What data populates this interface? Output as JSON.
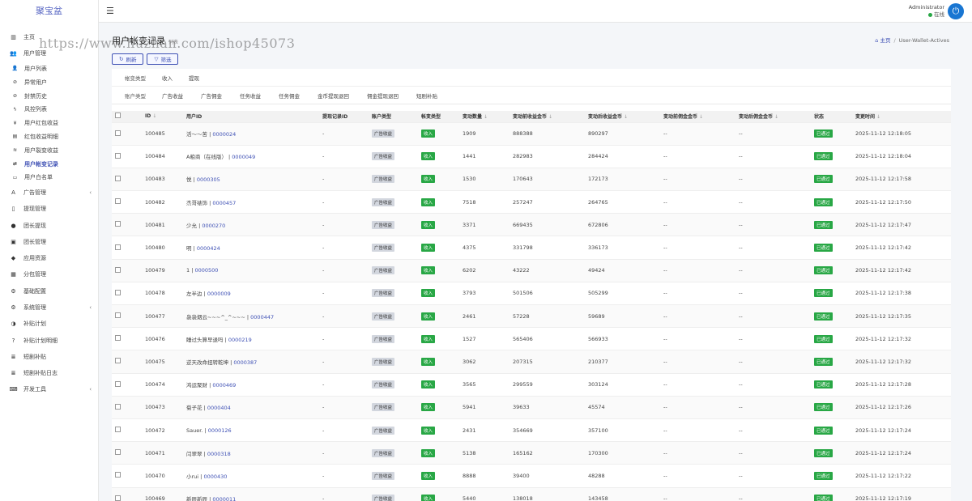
{
  "brand": "聚宝盆",
  "topbar": {
    "user_name": "Administrator",
    "user_status": "在线"
  },
  "watermark": "https://www.huzhan.com/ishop45073",
  "page": {
    "title": "用户帐变记录",
    "subtitle": "列表"
  },
  "breadcrumb": {
    "home": "主页",
    "current": "User-Wallet-Actives"
  },
  "buttons": {
    "refresh": "刷新",
    "filter": "筛选"
  },
  "sidebar": {
    "items": [
      {
        "label": "主页",
        "icon": "dashboard-icon",
        "sub": false
      },
      {
        "label": "用户管理",
        "icon": "users-icon",
        "sub": false
      },
      {
        "label": "用户列表",
        "icon": "user-list-icon",
        "sub": true
      },
      {
        "label": "异常用户",
        "icon": "ban-icon",
        "sub": true
      },
      {
        "label": "封禁历史",
        "icon": "ban-history-icon",
        "sub": true
      },
      {
        "label": "风控列表",
        "icon": "bolt-icon",
        "sub": true
      },
      {
        "label": "用户红包收益",
        "icon": "yen-icon",
        "sub": true
      },
      {
        "label": "红包收益明细",
        "icon": "ledger-icon",
        "sub": true
      },
      {
        "label": "用户裂变收益",
        "icon": "wifi-icon",
        "sub": true
      },
      {
        "label": "用户帐变记录",
        "icon": "exchange-icon",
        "sub": true,
        "active": true
      },
      {
        "label": "用户白名单",
        "icon": "id-card-icon",
        "sub": true
      },
      {
        "label": "广告管理",
        "icon": "ad-icon",
        "sub": false,
        "arrow": "‹"
      },
      {
        "label": "提现管理",
        "icon": "withdraw-icon",
        "sub": false
      },
      {
        "label": "团长提现",
        "icon": "leader-icon",
        "sub": false
      },
      {
        "label": "团长管理",
        "icon": "contact-icon",
        "sub": false
      },
      {
        "label": "应用资源",
        "icon": "android-icon",
        "sub": false
      },
      {
        "label": "分包管理",
        "icon": "package-icon",
        "sub": false
      },
      {
        "label": "基础配置",
        "icon": "cogs-icon",
        "sub": false
      },
      {
        "label": "系统管理",
        "icon": "gear-icon",
        "sub": false,
        "arrow": "‹"
      },
      {
        "label": "补贴计划",
        "icon": "pie-icon",
        "sub": false
      },
      {
        "label": "补贴计划明细",
        "icon": "question-icon",
        "sub": false
      },
      {
        "label": "短剧补贴",
        "icon": "list-icon",
        "sub": false
      },
      {
        "label": "短剧补贴日志",
        "icon": "list-log-icon",
        "sub": false
      },
      {
        "label": "开发工具",
        "icon": "keyboard-icon",
        "sub": false,
        "arrow": "‹"
      }
    ]
  },
  "filters": {
    "row1": {
      "label": "帐变类型",
      "options": [
        "收入",
        "提现"
      ]
    },
    "row2": {
      "label": "账户类型",
      "options": [
        "广告收益",
        "广告佣金",
        "任务收益",
        "任务佣金",
        "金币提现退回",
        "佣金提现退回",
        "短剧补贴"
      ]
    }
  },
  "table": {
    "columns": [
      "ID",
      "用户ID",
      "提现记录ID",
      "账户类型",
      "帐变类型",
      "变动数量",
      "变动前收益金币",
      "变动后收益金币",
      "变动前佣金金币",
      "变动后佣金金币",
      "状态",
      "变更时间"
    ],
    "rows": [
      {
        "id": "100485",
        "user": "活～～苦",
        "uid": "0000024",
        "wid": "-",
        "acct": "广告收益",
        "type": "收入",
        "amount": "1909",
        "before": "888388",
        "after": "890297",
        "cbefore": "--",
        "cafter": "--",
        "status": "已通过",
        "time": "2025-11-12 12:18:05"
      },
      {
        "id": "100484",
        "user": "A粮商（在线版）",
        "uid": "0000049",
        "wid": "-",
        "acct": "广告收益",
        "type": "收入",
        "amount": "1441",
        "before": "282983",
        "after": "284424",
        "cbefore": "--",
        "cafter": "--",
        "status": "已通过",
        "time": "2025-11-12 12:18:04"
      },
      {
        "id": "100483",
        "user": "悦",
        "uid": "0000305",
        "wid": "-",
        "acct": "广告收益",
        "type": "收入",
        "amount": "1530",
        "before": "170643",
        "after": "172173",
        "cbefore": "--",
        "cafter": "--",
        "status": "已通过",
        "time": "2025-11-12 12:17:58"
      },
      {
        "id": "100482",
        "user": "杰哥裱饰",
        "uid": "0000457",
        "wid": "-",
        "acct": "广告收益",
        "type": "收入",
        "amount": "7518",
        "before": "257247",
        "after": "264765",
        "cbefore": "--",
        "cafter": "--",
        "status": "已通过",
        "time": "2025-11-12 12:17:50"
      },
      {
        "id": "100481",
        "user": "少允",
        "uid": "0000270",
        "wid": "-",
        "acct": "广告收益",
        "type": "收入",
        "amount": "3371",
        "before": "669435",
        "after": "672806",
        "cbefore": "--",
        "cafter": "--",
        "status": "已通过",
        "time": "2025-11-12 12:17:47"
      },
      {
        "id": "100480",
        "user": "明",
        "uid": "0000424",
        "wid": "-",
        "acct": "广告收益",
        "type": "收入",
        "amount": "4375",
        "before": "331798",
        "after": "336173",
        "cbefore": "--",
        "cafter": "--",
        "status": "已通过",
        "time": "2025-11-12 12:17:42"
      },
      {
        "id": "100479",
        "user": "1",
        "uid": "0000500",
        "wid": "-",
        "acct": "广告收益",
        "type": "收入",
        "amount": "6202",
        "before": "43222",
        "after": "49424",
        "cbefore": "--",
        "cafter": "--",
        "status": "已通过",
        "time": "2025-11-12 12:17:42"
      },
      {
        "id": "100478",
        "user": "左半边",
        "uid": "0000009",
        "wid": "-",
        "acct": "广告收益",
        "type": "收入",
        "amount": "3793",
        "before": "501506",
        "after": "505299",
        "cbefore": "--",
        "cafter": "--",
        "status": "已通过",
        "time": "2025-11-12 12:17:38"
      },
      {
        "id": "100477",
        "user": "袅袅烟云~~~^_^~~~",
        "uid": "0000447",
        "wid": "-",
        "acct": "广告收益",
        "type": "收入",
        "amount": "2461",
        "before": "57228",
        "after": "59689",
        "cbefore": "--",
        "cafter": "--",
        "status": "已通过",
        "time": "2025-11-12 12:17:35"
      },
      {
        "id": "100476",
        "user": "睡过头算早退吗",
        "uid": "0000219",
        "wid": "-",
        "acct": "广告收益",
        "type": "收入",
        "amount": "1527",
        "before": "565406",
        "after": "566933",
        "cbefore": "--",
        "cafter": "--",
        "status": "已通过",
        "time": "2025-11-12 12:17:32"
      },
      {
        "id": "100475",
        "user": "逆天改命扭转乾坤",
        "uid": "0000387",
        "wid": "-",
        "acct": "广告收益",
        "type": "收入",
        "amount": "3062",
        "before": "207315",
        "after": "210377",
        "cbefore": "--",
        "cafter": "--",
        "status": "已通过",
        "time": "2025-11-12 12:17:32"
      },
      {
        "id": "100474",
        "user": "鸿运聚财",
        "uid": "0000469",
        "wid": "-",
        "acct": "广告收益",
        "type": "收入",
        "amount": "3565",
        "before": "299559",
        "after": "303124",
        "cbefore": "--",
        "cafter": "--",
        "status": "已通过",
        "time": "2025-11-12 12:17:28"
      },
      {
        "id": "100473",
        "user": "菊子花",
        "uid": "0000404",
        "wid": "-",
        "acct": "广告收益",
        "type": "收入",
        "amount": "5941",
        "before": "39633",
        "after": "45574",
        "cbefore": "--",
        "cafter": "--",
        "status": "已通过",
        "time": "2025-11-12 12:17:26"
      },
      {
        "id": "100472",
        "user": "Sauer.",
        "uid": "0000126",
        "wid": "-",
        "acct": "广告收益",
        "type": "收入",
        "amount": "2431",
        "before": "354669",
        "after": "357100",
        "cbefore": "--",
        "cafter": "--",
        "status": "已通过",
        "time": "2025-11-12 12:17:24"
      },
      {
        "id": "100471",
        "user": "闫翠翠",
        "uid": "0000318",
        "wid": "-",
        "acct": "广告收益",
        "type": "收入",
        "amount": "5138",
        "before": "165162",
        "after": "170300",
        "cbefore": "--",
        "cafter": "--",
        "status": "已通过",
        "time": "2025-11-12 12:17:24"
      },
      {
        "id": "100470",
        "user": "小rui",
        "uid": "0000430",
        "wid": "-",
        "acct": "广告收益",
        "type": "收入",
        "amount": "8888",
        "before": "39400",
        "after": "48288",
        "cbefore": "--",
        "cafter": "--",
        "status": "已通过",
        "time": "2025-11-12 12:17:22"
      },
      {
        "id": "100469",
        "user": "新辰新辰",
        "uid": "0000011",
        "wid": "-",
        "acct": "广告收益",
        "type": "收入",
        "amount": "5440",
        "before": "138018",
        "after": "143458",
        "cbefore": "--",
        "cafter": "--",
        "status": "已通过",
        "time": "2025-11-12 12:17:19"
      }
    ]
  },
  "colors": {
    "accent": "#3f51b5",
    "success": "#28a745",
    "tag_gray": "#d2d6de",
    "avatar": "#1976d2"
  }
}
